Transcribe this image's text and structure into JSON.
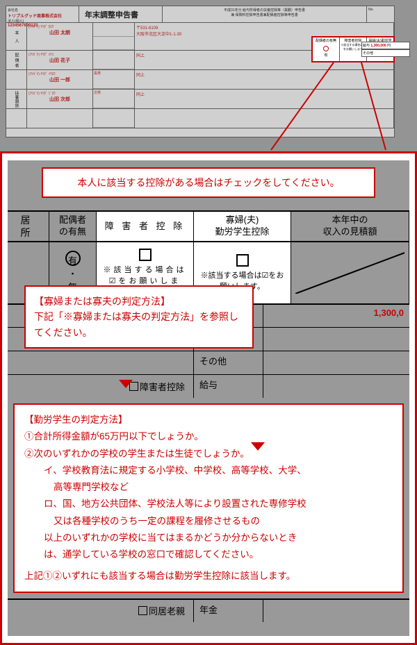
{
  "top": {
    "company_label": "会社名",
    "company_name": "トリプルグッド商事株式会社",
    "person_no_label": "法人(個人)",
    "person_no": "1234567890123",
    "form_title": "年末調整申告書",
    "form_desc1": "平成31年分 給与所得者の扶養控除等（異動）申告書",
    "form_desc2": "兼 保険料控除申告書兼配偶者控除等申告書",
    "no_label": "No.",
    "honnin": "本　人",
    "furigana1": "(ﾌﾘｶﾞﾅ) ﾔﾏﾀﾞ ﾀﾛｳ",
    "name1": "山田 太朗",
    "postal_label": "〒531-6109",
    "addr1": "大阪市北区大淀中1-1-30",
    "spouse_label": "配 偶 者",
    "furigana2": "(ﾌﾘｶﾞﾅ) ﾔﾏﾀﾞ ﾊﾅｺ",
    "name2": "山田 花子",
    "addr2": "同上",
    "fuyou_label": "扶養親族",
    "furigana3": "(ﾌﾘｶﾞﾅ) ﾔﾏﾀﾞ ｲﾁﾛｳ",
    "name3": "山田 一郎",
    "rel3": "長男",
    "furigana4": "(ﾌﾘｶﾞﾅ) ﾔﾏﾀﾞ ｼﾞﾛｳ",
    "name4": "山田 次郎",
    "rel4": "次男",
    "hl_col1": "配偶者の有無",
    "hl_col2": "障害者控除",
    "hl_col3": "寡婦(夫)勤労学生控除",
    "hl_check_note": "※該当する場合は☑をお願いします",
    "hl_yes": "有",
    "income_label": "給与",
    "income_amount": "1,300,000",
    "income_unit": "円",
    "other_label": "その他",
    "cb_disab": "□障害者控除",
    "cb_dokyo": "□同居老親"
  },
  "bottom": {
    "instruction": "本人に該当する控除がある場合はチェックをしてください。",
    "h_addr": "居　所",
    "h_spouse": "配偶者\nの有無",
    "h_disab": "障 害 者 控 除",
    "h_widow": "寡婦(夫)\n勤労学生控除",
    "h_income": "本年中の\n収入の見積額",
    "aru": "有",
    "dot": "・",
    "nashi": "無",
    "check_note": "※該当する場合は☑をお願いします。",
    "callout1_title": "【寡婦または寡夫の判定方法】",
    "callout1_body": "下記「※寡婦または寡夫の判定方法」を参照してください。",
    "callout2_title": "【勤労学生の判定方法】",
    "callout2_l1": "①合計所得金額が65万円以下でしょうか。",
    "callout2_l2": "②次のいずれかの学校の学生または生徒でしょうか。",
    "callout2_l3": "イ、学校教育法に規定する小学校、中学校、高等学校、大学、",
    "callout2_l3b": "高等専門学校など",
    "callout2_l4": "ロ、国、地方公共団体、学校法人等により設置された専修学校",
    "callout2_l4b": "又は各種学校のうち一定の課程を履修させるもの",
    "callout2_l5": "以上のいずれかの学校に当てはまるかどうか分からないとき",
    "callout2_l5b": "は、通学している学校の窓口で確認してください。",
    "callout2_last": "上記①②いずれにも該当する場合は勤労学生控除に該当します。",
    "r_kyuyo": "給与",
    "r_nenkin": "年金",
    "r_sonota": "その他",
    "r_amount": "1,300,0",
    "cb_disab": "障害者控除",
    "cb_dokyo": "同居老親"
  }
}
